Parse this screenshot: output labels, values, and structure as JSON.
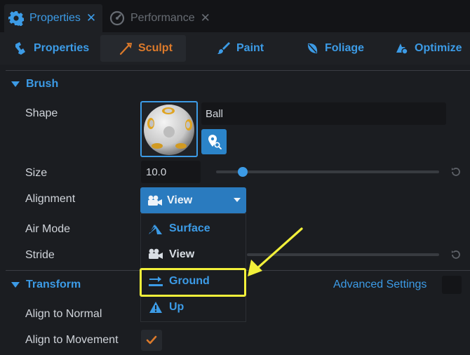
{
  "tabs": [
    {
      "label": "Properties",
      "icon": "gear-icon",
      "active": true
    },
    {
      "label": "Performance",
      "icon": "gauge-icon",
      "active": false
    }
  ],
  "tab_close_glyph": "✕",
  "categories": [
    {
      "label": "Properties",
      "icon": "properties-icon"
    },
    {
      "label": "Sculpt",
      "icon": "sculpt-icon",
      "selected": true
    },
    {
      "label": "Paint",
      "icon": "paint-brush-icon"
    },
    {
      "label": "Foliage",
      "icon": "foliage-icon"
    },
    {
      "label": "Optimize",
      "icon": "optimize-icon"
    }
  ],
  "brush": {
    "title": "Brush",
    "shape_label": "Shape",
    "shape_value": "Ball",
    "size_label": "Size",
    "size_value": "10.0",
    "alignment_label": "Alignment",
    "alignment_value": "View",
    "air_mode_label": "Air Mode",
    "stride_label": "Stride"
  },
  "alignment_options": [
    {
      "label": "Surface",
      "icon": "surface-icon"
    },
    {
      "label": "View",
      "icon": "camera-icon"
    },
    {
      "label": "Ground",
      "icon": "ground-icon"
    },
    {
      "label": "Up",
      "icon": "up-icon"
    }
  ],
  "transform": {
    "title": "Transform",
    "advanced_settings": "Advanced Settings",
    "align_normal_label": "Align to Normal",
    "align_movement_label": "Align to Movement",
    "align_movement_checked": true
  },
  "colors": {
    "accent": "#3c9be6",
    "selected_tab": "#dc7a2b",
    "highlight": "#f2f03a",
    "dropdown_bg": "#2a7bbf"
  }
}
